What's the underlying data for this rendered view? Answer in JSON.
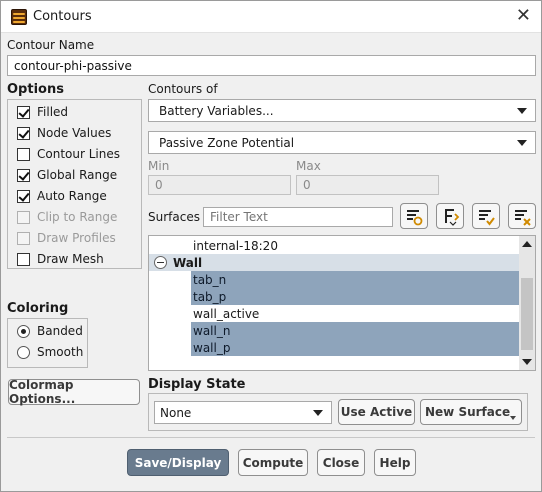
{
  "window": {
    "title": "Contours",
    "close_glyph": "✕"
  },
  "contour_name": {
    "label": "Contour Name",
    "value": "contour-phi-passive"
  },
  "options": {
    "label": "Options",
    "items": [
      {
        "label": "Filled",
        "checked": true,
        "enabled": true
      },
      {
        "label": "Node Values",
        "checked": true,
        "enabled": true
      },
      {
        "label": "Contour Lines",
        "checked": false,
        "enabled": true
      },
      {
        "label": "Global Range",
        "checked": true,
        "enabled": true
      },
      {
        "label": "Auto Range",
        "checked": true,
        "enabled": true
      },
      {
        "label": "Clip to Range",
        "checked": false,
        "enabled": false
      },
      {
        "label": "Draw Profiles",
        "checked": false,
        "enabled": false
      },
      {
        "label": "Draw Mesh",
        "checked": false,
        "enabled": true
      }
    ]
  },
  "coloring": {
    "label": "Coloring",
    "options": [
      {
        "label": "Banded",
        "selected": true
      },
      {
        "label": "Smooth",
        "selected": false
      }
    ]
  },
  "colormap_button": "Colormap Options...",
  "contours_of": {
    "label": "Contours of",
    "category": "Battery Variables...",
    "variable": "Passive Zone Potential"
  },
  "range": {
    "min_label": "Min",
    "min_value": "0",
    "max_label": "Max",
    "max_value": "0"
  },
  "surfaces": {
    "label": "Surfaces",
    "filter_placeholder": "Filter Text",
    "icons": [
      "new-surface-icon",
      "select-surfaces-icon",
      "select-all-icon",
      "deselect-all-icon"
    ],
    "items": [
      {
        "label": "internal-18:20",
        "selected": false,
        "group": false
      },
      {
        "label": "Wall",
        "selected": false,
        "group": true
      },
      {
        "label": "tab_n",
        "selected": true,
        "group": false
      },
      {
        "label": "tab_p",
        "selected": true,
        "group": false
      },
      {
        "label": "wall_active",
        "selected": false,
        "group": false
      },
      {
        "label": "wall_n",
        "selected": true,
        "group": false
      },
      {
        "label": "wall_p",
        "selected": true,
        "group": false
      }
    ]
  },
  "display_state": {
    "label": "Display State",
    "value": "None",
    "use_active": "Use Active",
    "new_surface": "New Surface"
  },
  "footer": {
    "save_display": "Save/Display",
    "compute": "Compute",
    "close": "Close",
    "help": "Help"
  },
  "colors": {
    "selection": "#8ea4bb",
    "group_row": "#d7dfe7",
    "primary_button": "#697b8e"
  }
}
